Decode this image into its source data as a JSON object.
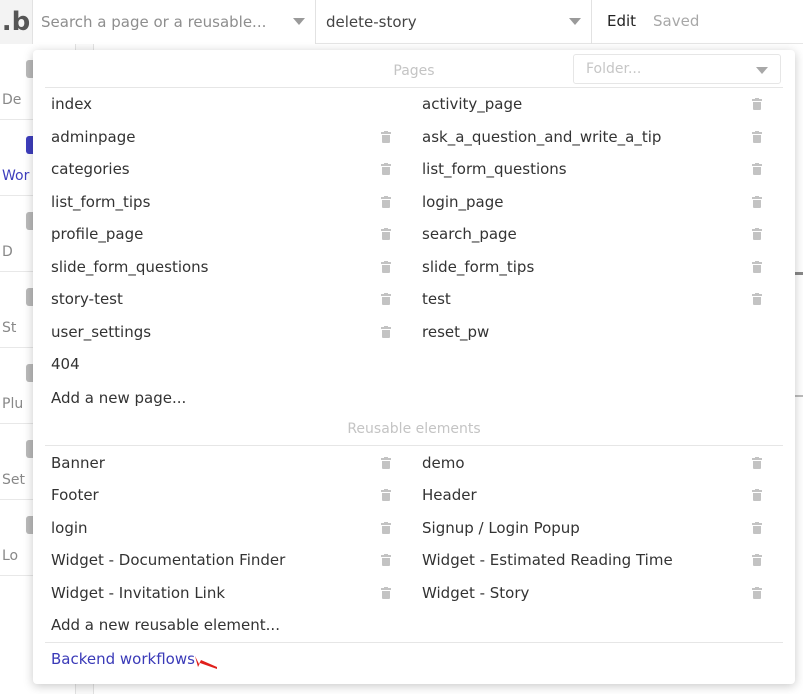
{
  "topbar": {
    "logo": ".b",
    "search_placeholder": "Search a page or a reusable...",
    "current_page": "delete-story",
    "edit_label": "Edit",
    "saved_label": "Saved"
  },
  "sidenav": {
    "items": [
      {
        "label": "De"
      },
      {
        "label": "Wor"
      },
      {
        "label": "D"
      },
      {
        "label": "St"
      },
      {
        "label": "Plu"
      },
      {
        "label": "Set"
      },
      {
        "label": "Lo"
      }
    ]
  },
  "dropdown": {
    "pages_header": "Pages",
    "folder_placeholder": "Folder...",
    "pages_left": [
      {
        "name": "index",
        "deletable": false
      },
      {
        "name": "adminpage",
        "deletable": true
      },
      {
        "name": "categories",
        "deletable": true
      },
      {
        "name": "list_form_tips",
        "deletable": true
      },
      {
        "name": "profile_page",
        "deletable": true
      },
      {
        "name": "slide_form_questions",
        "deletable": true
      },
      {
        "name": "story-test",
        "deletable": true
      },
      {
        "name": "user_settings",
        "deletable": true
      },
      {
        "name": "404",
        "deletable": false
      }
    ],
    "pages_right": [
      {
        "name": "activity_page",
        "deletable": true
      },
      {
        "name": "ask_a_question_and_write_a_tip",
        "deletable": true
      },
      {
        "name": "list_form_questions",
        "deletable": true
      },
      {
        "name": "login_page",
        "deletable": true
      },
      {
        "name": "search_page",
        "deletable": true
      },
      {
        "name": "slide_form_tips",
        "deletable": true
      },
      {
        "name": "test",
        "deletable": true
      },
      {
        "name": "reset_pw",
        "deletable": false
      }
    ],
    "add_page": "Add a new page...",
    "reusables_header": "Reusable elements",
    "reusables_left": [
      {
        "name": "Banner",
        "deletable": true
      },
      {
        "name": "Footer",
        "deletable": true
      },
      {
        "name": "login",
        "deletable": true
      },
      {
        "name": "Widget - Documentation Finder",
        "deletable": true
      },
      {
        "name": "Widget - Invitation Link",
        "deletable": true
      }
    ],
    "reusables_right": [
      {
        "name": "demo",
        "deletable": true
      },
      {
        "name": "Header",
        "deletable": true
      },
      {
        "name": "Signup / Login Popup",
        "deletable": true
      },
      {
        "name": "Widget - Estimated Reading Time",
        "deletable": true
      },
      {
        "name": "Widget - Story",
        "deletable": true
      }
    ],
    "add_reusable": "Add a new reusable element...",
    "backend_workflows": "Backend workflows"
  },
  "colors": {
    "accent": "#3a3ab8",
    "annotation_arrow": "#e0201c",
    "muted_header": "#c4c4c4"
  }
}
